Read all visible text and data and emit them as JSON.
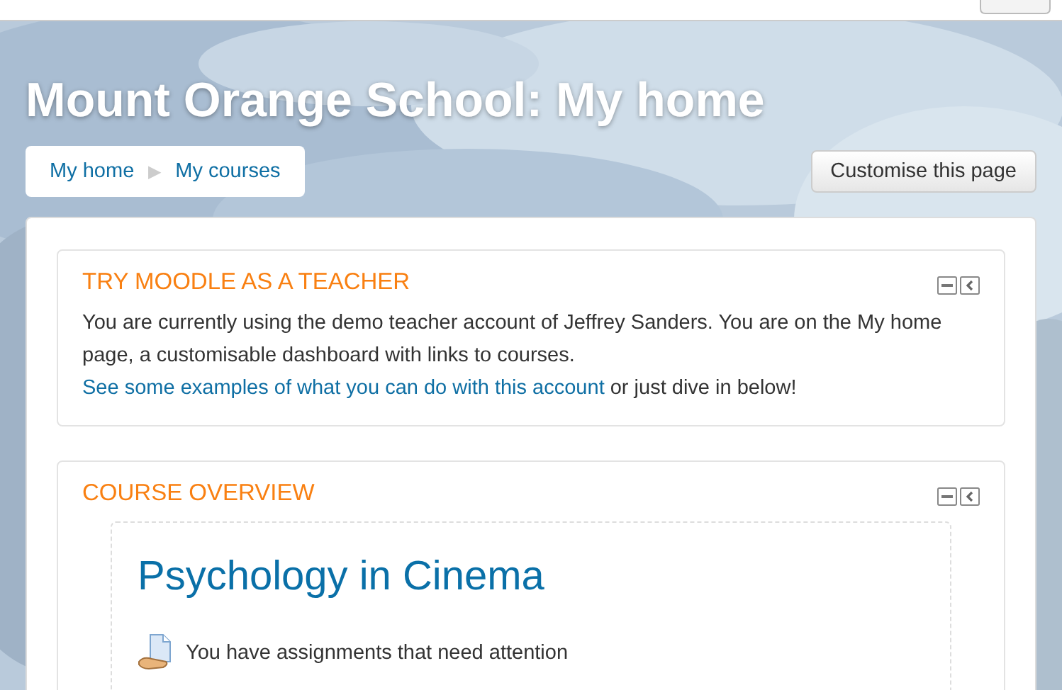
{
  "header": {
    "title": "Mount Orange School: My home"
  },
  "breadcrumb": {
    "items": [
      {
        "label": "My home"
      },
      {
        "label": "My courses"
      }
    ],
    "separator": "▶"
  },
  "customise_button": "Customise this page",
  "blocks": [
    {
      "kind": "text",
      "title": "TRY MOODLE AS A TEACHER",
      "text": "You are currently using the demo teacher account of Jeffrey Sanders. You are on the My home page, a customisable dashboard with links to courses. ",
      "link": "See some examples of what you can do with this account",
      "text_end": " or just dive in below!"
    },
    {
      "kind": "courses",
      "title": "COURSE OVERVIEW",
      "course": "Psychology in Cinema",
      "notice": "You have assignments that need attention"
    }
  ]
}
